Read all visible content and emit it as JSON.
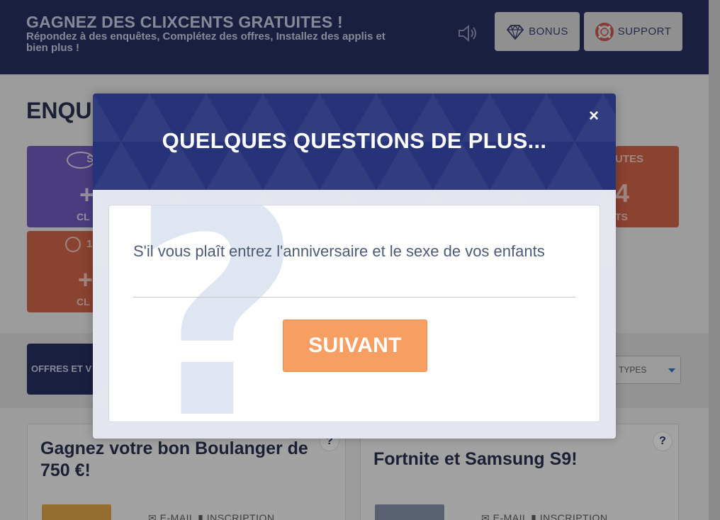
{
  "header": {
    "title": "GAGNEZ DES CLIXCENTS GRATUITES !",
    "subtitle": "Répondez à des enquêtes, Complétez des offres, Installez des applis et bien plus !",
    "bonus_label": "BONUS",
    "support_label": "SUPPORT",
    "speaker_icon": "speaker-icon",
    "bonus_icon": "diamond-icon",
    "support_icon": "lifebuoy-icon"
  },
  "main": {
    "heading": "ENQU",
    "cards": {
      "purple_top": "S",
      "purple_big": "+",
      "purple_bottom": "CL",
      "red1_top": "1",
      "red1_big": "+",
      "red1_bottom": "CL",
      "red2_top": "UTES",
      "red2_big": "4",
      "red2_bottom": "TS"
    }
  },
  "filter": {
    "offers_tab": "OFFRES ET V",
    "type_select": "TYPES"
  },
  "offers": [
    {
      "title": "Gagnez votre bon Boulanger de 750 €!",
      "meta_email": "E-MAIL",
      "meta_signup": "INSCRIPTION",
      "help": "?"
    },
    {
      "title": "Fortnite et Samsung S9!",
      "meta_email": "E-MAIL",
      "meta_signup": "INSCRIPTION",
      "help": "?"
    }
  ],
  "modal": {
    "title": "QUELQUES QUESTIONS DE PLUS...",
    "close": "×",
    "question": "S'il vous plaît entrez l'anniversaire et le sexe de vos enfants",
    "next_button": "SUIVANT",
    "watermark": "?"
  },
  "colors": {
    "header_bg": "#1b2257",
    "modal_header_bg": "#273379",
    "accent_orange": "#f79e63",
    "card_purple": "#6a4fbd",
    "card_red": "#cf5b40"
  }
}
